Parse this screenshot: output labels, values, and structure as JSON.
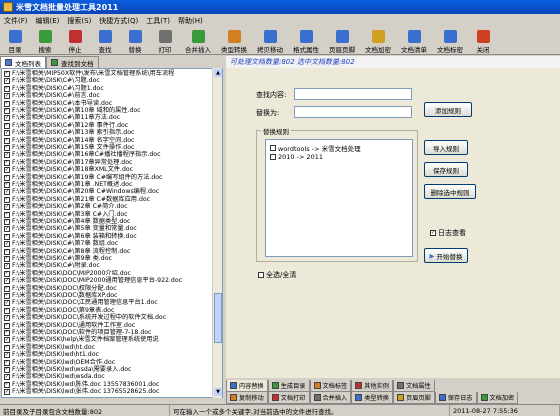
{
  "window": {
    "title": "米雪文档批量处理工具2011"
  },
  "menu": [
    "文件(F)",
    "编辑(E)",
    "搜索(S)",
    "快捷方式(Q)",
    "工具(T)",
    "帮助(H)"
  ],
  "toolbar": [
    {
      "label": "目录",
      "icon": "folder-icon",
      "color": "#3a6fd0"
    },
    {
      "label": "搜索",
      "icon": "search-icon",
      "color": "#3a9a3a"
    },
    {
      "label": "停止",
      "icon": "stop-icon",
      "color": "#c03030"
    },
    {
      "label": "查找",
      "icon": "find-icon",
      "color": "#3a6fd0"
    },
    {
      "label": "替换",
      "icon": "replace-icon",
      "color": "#3a6fd0"
    },
    {
      "label": "打印",
      "icon": "print-icon",
      "color": "#707070"
    },
    {
      "label": "合并插入",
      "icon": "merge-icon",
      "color": "#3a9a3a"
    },
    {
      "label": "类型转换",
      "icon": "convert-icon",
      "color": "#d08020"
    },
    {
      "label": "拷贝移动",
      "icon": "copy-icon",
      "color": "#3a6fd0"
    },
    {
      "label": "格式属性",
      "icon": "format-icon",
      "color": "#3a6fd0"
    },
    {
      "label": "页眉页脚",
      "icon": "header-icon",
      "color": "#3a6fd0"
    },
    {
      "label": "文档加密",
      "icon": "lock-icon",
      "color": "#d0a020"
    },
    {
      "label": "文档清单",
      "icon": "list-icon",
      "color": "#3a6fd0"
    },
    {
      "label": "文档标密",
      "icon": "secret-icon",
      "color": "#3a6fd0"
    },
    {
      "label": "关闭",
      "icon": "close-icon",
      "color": "#d04020"
    }
  ],
  "left_tabs": [
    "文档列表",
    "查找到文档"
  ],
  "files": [
    "F:\\米雪相关\\MIP50X软件\\发布\\米雪文档管理系统\\用车流程",
    "F:\\米雪相关\\DISK\\C#\\习题.doc",
    "F:\\米雪相关\\DISK\\C#\\习题1.doc",
    "F:\\米雪相关\\DISK\\C#\\前言.doc",
    "F:\\米雪相关\\DISK\\C#\\本书导读.doc",
    "F:\\米雪相关\\DISK\\C#\\第10章  域和的属性.doc",
    "F:\\米雪相关\\DISK\\C#\\第11章方法.doc",
    "F:\\米雪相关\\DISK\\C#\\第12章  事件行.doc",
    "F:\\米雪相关\\DISK\\C#\\第13章   索引指示.doc",
    "F:\\米雪相关\\DISK\\C#\\第14章  名字空间.doc",
    "F:\\米雪相关\\DISK\\C#\\第15章   文件操作.doc",
    "F:\\米雪相关\\DISK\\C#\\第16章C#播社播程序指示.doc",
    "F:\\米雪相关\\DISK\\C#\\第17章异常处理.doc",
    "F:\\米雪相关\\DISK\\C#\\第18章XML文件.doc",
    "F:\\米雪相关\\DISK\\C#\\第19章  C#编写组件的方法.doc",
    "F:\\米雪相关\\DISK\\C#\\第1章  .NET概述.doc",
    "F:\\米雪相关\\DISK\\C#\\第20章  C#Windows编程.doc",
    "F:\\米雪相关\\DISK\\C#\\第21章  C#数据库应用.doc",
    "F:\\米雪相关\\DISK\\C#\\第2章  C#简介.doc",
    "F:\\米雪相关\\DISK\\C#\\第3章  C#入门.doc",
    "F:\\米雪相关\\DISK\\C#\\第4章  数据类型.doc",
    "F:\\米雪相关\\DISK\\C#\\第5章  变量和常量.doc",
    "F:\\米雪相关\\DISK\\C#\\第6章  装箱和转换.doc",
    "F:\\米雪相关\\DISK\\C#\\第7章  数组.doc",
    "F:\\米雪相关\\DISK\\C#\\第8章  流程控制.doc",
    "F:\\米雪相关\\DISK\\C#\\第9章  类.doc",
    "F:\\米雪相关\\DISK\\C#\\附录.doc",
    "F:\\米雪相关\\DISK\\DOC\\MIP2000介绍.doc",
    "F:\\米雪相关\\DISK\\DOC\\MIP2000通用管理信息平台-922.doc",
    "F:\\米雪相关\\DISK\\DOC\\权限分配.doc",
    "F:\\米雪相关\\DISK\\DOC\\数据库XP.doc",
    "F:\\米雪相关\\DISK\\DOC\\江民通用管理信息平台1.doc",
    "F:\\米雪相关\\DISK\\DOC\\第9章表.doc",
    "F:\\米雪相关\\DISK\\DOC\\系统开发过程中的软件文档.doc",
    "F:\\米雪相关\\DISK\\DOC\\通用软件工作室.doc",
    "F:\\米雪相关\\DISK\\DOC\\软件的项目管理-7-18.doc",
    "F:\\米雪相关\\DISK\\help\\米雪文件档案管理系统使用说",
    "F:\\米雪相关\\DISK\\lwd\\ht.doc",
    "F:\\米雪相关\\DISK\\lwd\\ht1.doc",
    "F:\\米雪相关\\DISK\\lwd\\OEM合作.doc",
    "F:\\米雪相关\\DISK\\lwd\\wsda\\需要录入.doc",
    "F:\\米雪相关\\DISK\\lwd\\wsda.doc",
    "F:\\米雪相关\\DISK\\lwd\\陈伟.doc  13557836001.doc",
    "F:\\米雪相关\\DISK\\lwd\\张伟.doc  13765528625.doc"
  ],
  "status_strip": "可处理文档数量:802  选中文档数量:802",
  "form": {
    "search_label": "查找内容:",
    "replace_label": "替换为:",
    "search_value": "",
    "replace_value": "",
    "add_rule": "添加规则",
    "rules_title": "替换规则",
    "rules": [
      "wordtools -> 米雪文档处理",
      "2010 -> 2011"
    ],
    "import_rule": "导入规则",
    "save_rule": "保存规则",
    "delete_rule": "删除选中规则",
    "log_check": "日志查看",
    "log_checked": true,
    "start_replace": "开始替换",
    "select_all": "全选/全清"
  },
  "bottom_tabs_row1": [
    "内容替换",
    "生成目录",
    "文档标签",
    "其他实例",
    "文档属性"
  ],
  "bottom_tabs_row2": [
    "复制移动",
    "文档打印",
    "合并插入",
    "类型转换",
    "页眉页脚",
    "保存日志",
    "文档加密"
  ],
  "statusbar": {
    "left": "前目录及子目录包含文档数量:802",
    "middle": "可在输入一个或多个关键字,对当前选中的文件进行查找。",
    "right": "2011-08-27  7:55:36"
  }
}
